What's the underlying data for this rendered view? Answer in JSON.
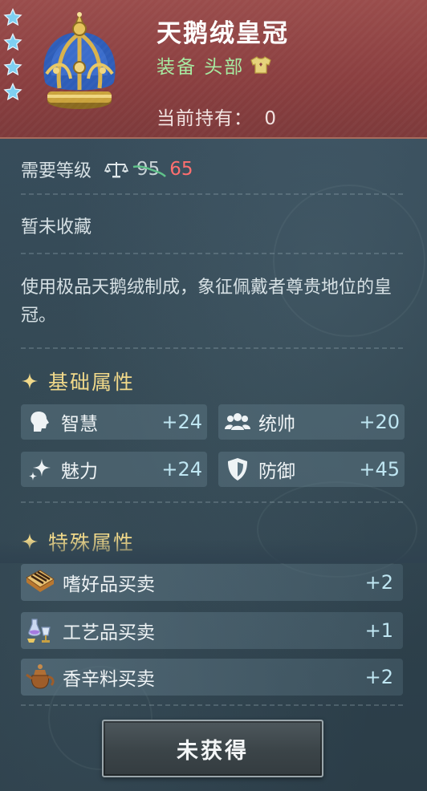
{
  "header": {
    "title": "天鹅绒皇冠",
    "type_label": "装备 头部",
    "holding_label": "当前持有：",
    "holding_value": "0",
    "star_count": 4,
    "star_color": "#6fc7ee",
    "icons": [
      "star-icon",
      "crown-icon",
      "shirt-icon"
    ]
  },
  "level": {
    "label": "需要等级",
    "old_value": "95",
    "new_value": "65",
    "icon": "scale-icon"
  },
  "collection_status": "暂未收藏",
  "description": "使用极品天鹅绒制成，象征佩戴者尊贵地位的皇冠。",
  "basic_attributes": {
    "heading": "基础属性",
    "items": [
      {
        "icon": "head-icon",
        "label": "智慧",
        "value": "+24"
      },
      {
        "icon": "group-icon",
        "label": "统帅",
        "value": "+20"
      },
      {
        "icon": "sparkle-icon",
        "label": "魅力",
        "value": "+24"
      },
      {
        "icon": "shield-icon",
        "label": "防御",
        "value": "+45"
      }
    ]
  },
  "special_attributes": {
    "heading": "特殊属性",
    "items": [
      {
        "icon": "cigar-box-icon",
        "label": "嗜好品买卖",
        "value": "+2"
      },
      {
        "icon": "glassware-icon",
        "label": "工艺品买卖",
        "value": "+1"
      },
      {
        "icon": "teapot-icon",
        "label": "香辛料买卖",
        "value": "+2"
      }
    ]
  },
  "action_button": "未获得",
  "colors": {
    "header_bg": "#8a3f40",
    "panel_bg": "#2f4250",
    "type_green": "#a6eaa0",
    "heading_gold": "#f1d98a",
    "level_red": "#ff6f6f",
    "value_blue": "#bfe6f2"
  }
}
